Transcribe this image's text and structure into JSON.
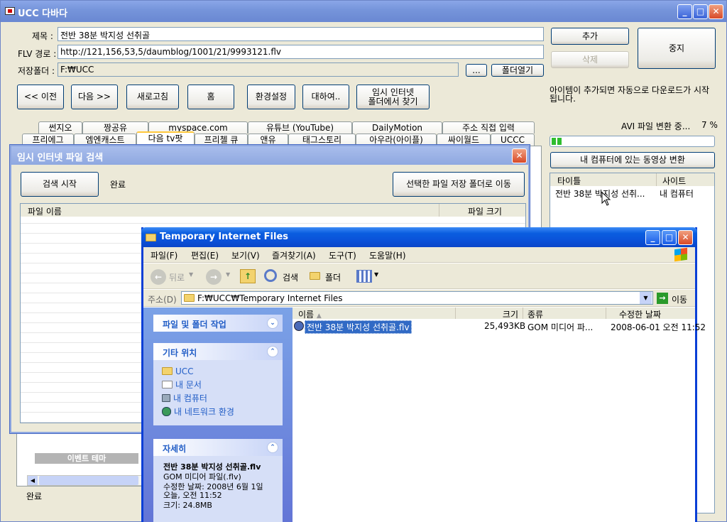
{
  "main": {
    "title": "UCC 다바다",
    "title_label": "제목 :",
    "title_value": "전반 38분 박지성 선취골",
    "flv_label": "FLV 경로 :",
    "flv_value": "http://121,156,53,5/daumblog/1001/21/9993121.flv",
    "save_label": "저장폴더 :",
    "save_value": "F:₩UCC",
    "browse_label": "...",
    "open_folder_label": "폴더열기",
    "add_label": "추가",
    "delete_label": "삭제",
    "stop_label": "중지",
    "nav": [
      "<< 이전",
      "다음 >>",
      "새로고침",
      "홈",
      "환경설정",
      "대하여..",
      "임시 인터넷\n폴더에서 찾기"
    ],
    "hint": "아이템이 추가되면 자동으로 다운로드가 시작됩니다.",
    "avi_status": "AVI 파일 변환 중...",
    "avi_percent": "7 %",
    "progress": 0.07,
    "convert_label": "내 컴퓨터에 있는 동영상 변환",
    "tabs_row1": [
      "썬지오",
      "짱공유",
      "myspace.com",
      "유튜브 (YouTube)",
      "DailyMotion",
      "주소 직접 입력"
    ],
    "tabs_row2": [
      "프리에그",
      "엠엔캐스트",
      "다음 tv팟",
      "프리첼 큐",
      "앤유",
      "태그스토리",
      "아우라(아이플)",
      "싸이월드",
      "UCCC"
    ],
    "list_headers": [
      "타이틀",
      "사이트"
    ],
    "list_rows": [
      [
        "전반 38분 박지성 선취...",
        "내 컴퓨터"
      ]
    ],
    "event_label": "이벤트 테마",
    "status": "완료"
  },
  "search_dialog": {
    "title": "임시 인터넷 파일 검색",
    "start_label": "검색 시작",
    "status": "완료",
    "move_label": "선택한 파일 저장 폴더로 이동",
    "col_name": "파일 이름",
    "col_size": "파일 크기"
  },
  "explorer": {
    "title": "Temporary Internet Files",
    "menu": [
      "파일(F)",
      "편집(E)",
      "보기(V)",
      "즐겨찾기(A)",
      "도구(T)",
      "도움말(H)"
    ],
    "back_label": "뒤로",
    "search_label": "검색",
    "folder_label": "폴더",
    "address_label": "주소(D)",
    "address_value": "F:₩UCC₩Temporary Internet Files",
    "go_label": "이동",
    "columns": [
      "이름",
      "크기",
      "종류",
      "수정한 날짜"
    ],
    "file": {
      "name": "전반 38분 박지성 선취골.flv",
      "size": "25,493KB",
      "type": "GOM 미디어 파...",
      "date": "2008-06-01 오전 11:52"
    },
    "task_file": "파일 및 폴더 작업",
    "task_other": "기타 위치",
    "other_links": [
      "UCC",
      "내 문서",
      "내 컴퓨터",
      "내 네트워크 환경"
    ],
    "task_detail": "자세히",
    "detail_name": "전반 38분 박지성 선취골.flv",
    "detail_type": "GOM 미디어 파일(.flv)",
    "detail_date": "수정한 날짜: 2008년 6월 1일 오늘, 오전 11:52",
    "detail_size": "크기: 24.8MB"
  }
}
